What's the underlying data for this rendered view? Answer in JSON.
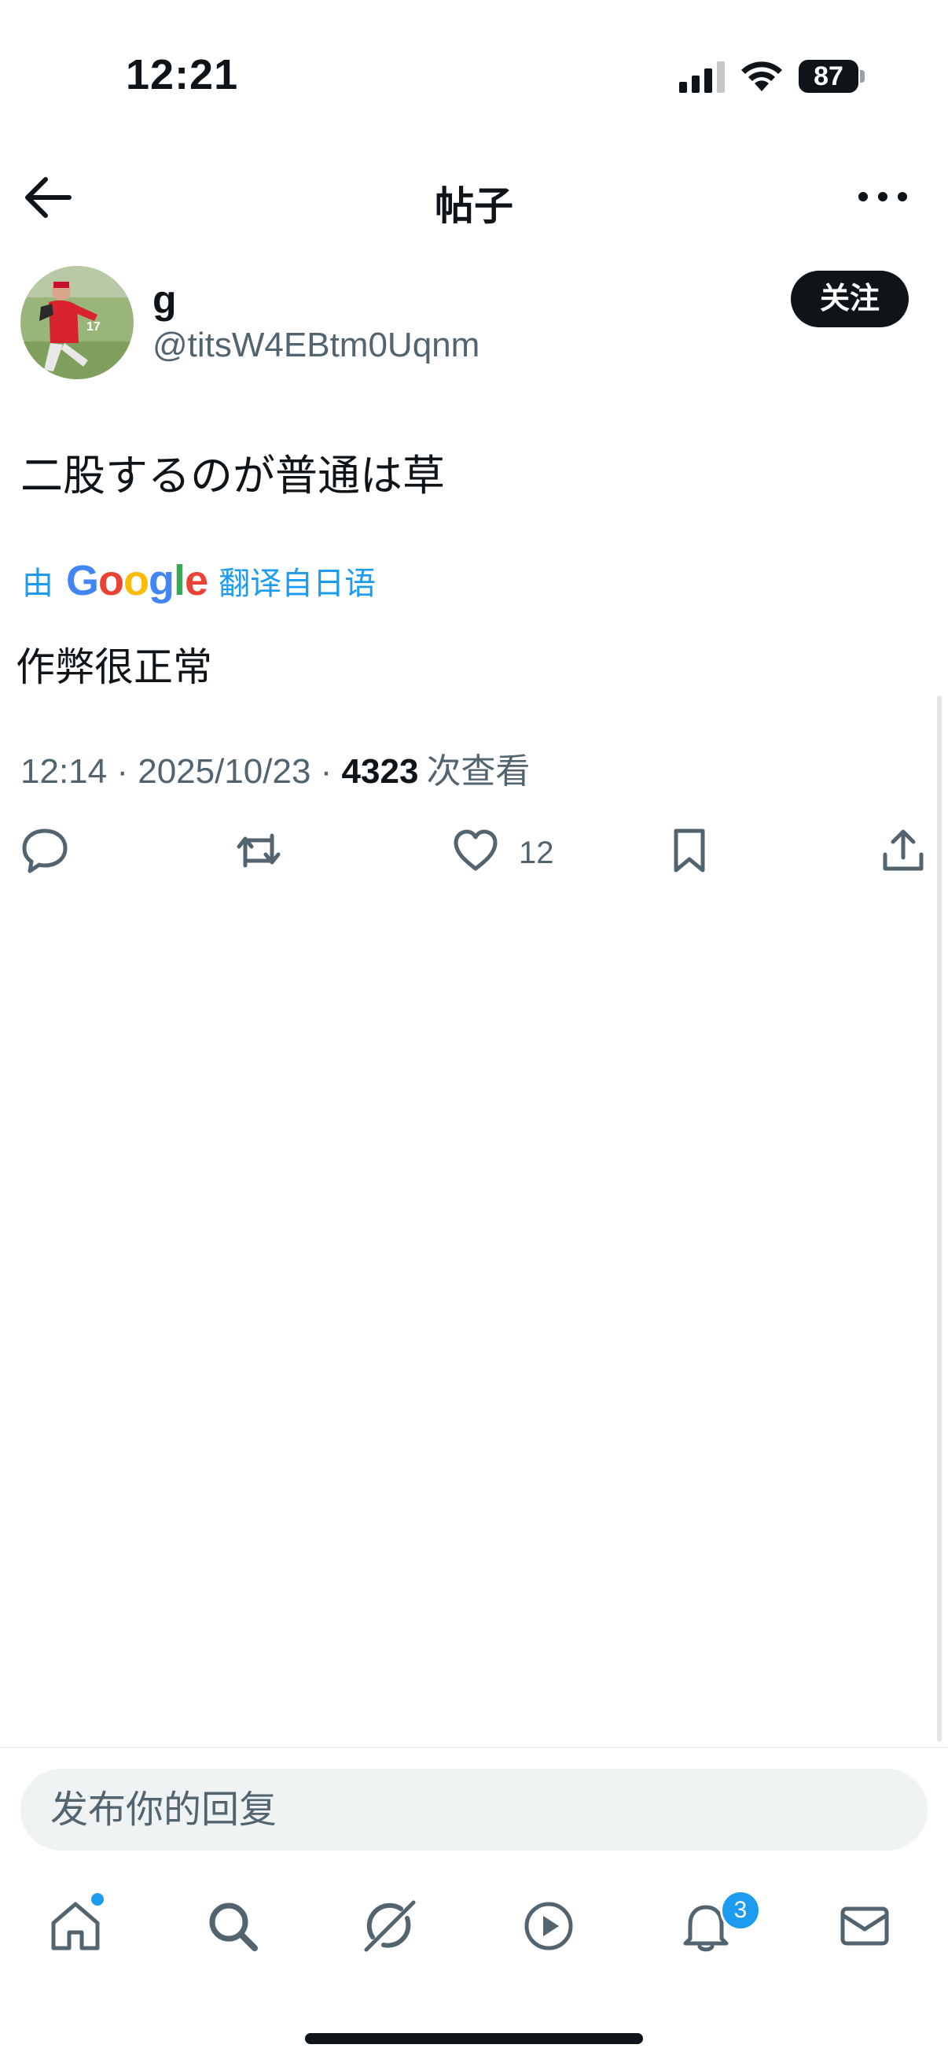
{
  "status_bar": {
    "time": "12:21",
    "battery": "87"
  },
  "header": {
    "title": "帖子"
  },
  "author": {
    "name": "g",
    "handle": "@titsW4EBtm0Uqnm",
    "follow_label": "关注"
  },
  "post": {
    "text": "二股するのが普通は草",
    "translate_prefix": "由",
    "translate_google": "Google",
    "translate_suffix": "翻译自日语",
    "translated_text": "作弊很正常",
    "time": "12:14",
    "date": "2025/10/23",
    "views": "4323",
    "views_label": "次查看",
    "like_count": "12"
  },
  "colors": {
    "accent": "#1d9bf0",
    "text": "#0f1419",
    "secondary": "#536471"
  },
  "reply": {
    "placeholder": "发布你的回复"
  },
  "tabbar": {
    "items": [
      "home-icon",
      "search-icon",
      "grok-icon",
      "video-icon",
      "bell-icon",
      "mail-icon"
    ],
    "notification_badge": "3"
  }
}
